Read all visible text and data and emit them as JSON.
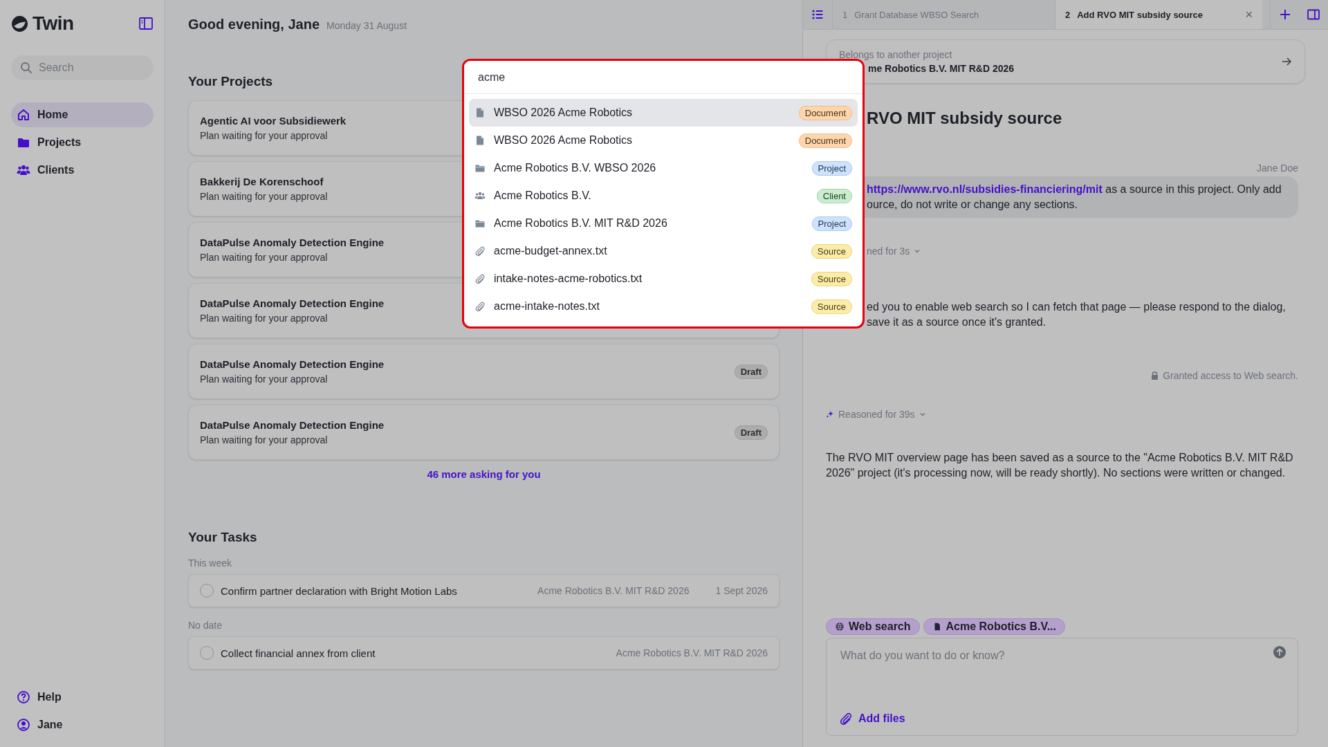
{
  "sidebar": {
    "logo": "Twin",
    "search": {
      "placeholder": "Search"
    },
    "nav": [
      {
        "label": "Home",
        "selected": true
      },
      {
        "label": "Projects",
        "selected": false
      },
      {
        "label": "Clients",
        "selected": false
      }
    ],
    "footer": [
      {
        "label": "Help"
      },
      {
        "label": "Jane"
      }
    ]
  },
  "header": {
    "greeting": "Good evening, Jane",
    "date": "Monday 31 August"
  },
  "projects": {
    "title": "Your Projects",
    "items": [
      {
        "name": "Agentic AI voor Subsidiewerk",
        "status": "Plan waiting for your approval"
      },
      {
        "name": "Bakkerij De Korenschoof",
        "status": "Plan waiting for your approval"
      },
      {
        "name": "DataPulse Anomaly Detection Engine",
        "status": "Plan waiting for your approval"
      },
      {
        "name": "DataPulse Anomaly Detection Engine",
        "status": "Plan waiting for your approval"
      },
      {
        "name": "DataPulse Anomaly Detection Engine",
        "status": "Plan waiting for your approval",
        "badge": "Draft"
      },
      {
        "name": "DataPulse Anomaly Detection Engine",
        "status": "Plan waiting for your approval",
        "badge": "Draft"
      }
    ],
    "more_link": "46 more asking for you"
  },
  "tasks": {
    "title": "Your Tasks",
    "groups": [
      {
        "label": "This week",
        "items": [
          {
            "title": "Confirm partner declaration with Bright Motion Labs",
            "project": "Acme Robotics B.V. MIT R&D 2026",
            "due": "1 Sept 2026",
            "checked": false
          }
        ]
      },
      {
        "label": "No date",
        "items": [
          {
            "title": "Collect financial annex from client",
            "project": "Acme Robotics B.V. MIT R&D 2026",
            "checked": false
          }
        ]
      }
    ]
  },
  "chat": {
    "tabs": [
      {
        "number": "1",
        "label": "Grant Database WBSO Search",
        "selected": false
      },
      {
        "number": "2",
        "label": "Add RVO MIT subsidy source",
        "selected": true,
        "close": "×"
      }
    ],
    "project_card": {
      "label": "Belongs to another project",
      "name": "me Robotics B.V. MIT R&D 2026"
    },
    "title": "RVO MIT subsidy source",
    "messages": [
      {
        "kind": "user",
        "author": "Jane Doe",
        "link": "https://www.rvo.nl/subsidies-financiering/mit",
        "lines": [
          "as a source in this project. Only add",
          "ource, do not write or change any sections."
        ]
      },
      {
        "kind": "reasoning",
        "text": "ned for 3s",
        "partial": true
      },
      {
        "kind": "reply",
        "lines": [
          "ed you to enable web search so I can fetch that page — please respond to the dialog,",
          "save it as a source once it's granted."
        ]
      },
      {
        "kind": "notice",
        "text": "Granted access to Web search."
      },
      {
        "kind": "reasoning",
        "text": "Reasoned for 39s",
        "partial": false
      },
      {
        "kind": "reply",
        "text": "The RVO MIT overview page has been saved as a source to the \"Acme Robotics B.V. MIT R&D 2026\" project (it's processing now, will be ready shortly). No sections were written or changed."
      }
    ],
    "chips": [
      {
        "label": "Web search",
        "kind": "web"
      },
      {
        "label": "Acme Robotics B.V...",
        "kind": "document"
      }
    ],
    "composer": {
      "placeholder": "What do you want to do or know?",
      "add_files": "Add files"
    }
  },
  "search_popup": {
    "query": "acme",
    "results": [
      {
        "title": "WBSO 2026 Acme Robotics",
        "kind": "document",
        "badge": "Document",
        "selected": true
      },
      {
        "title": "WBSO 2026 Acme Robotics",
        "kind": "document",
        "badge": "Document",
        "selected": false
      },
      {
        "title": "Acme Robotics B.V. WBSO 2026",
        "kind": "project",
        "badge": "Project",
        "selected": false
      },
      {
        "title": "Acme Robotics B.V.",
        "kind": "client",
        "badge": "Client",
        "selected": false
      },
      {
        "title": "Acme Robotics B.V. MIT R&D 2026",
        "kind": "project",
        "badge": "Project",
        "selected": false
      },
      {
        "title": "acme-budget-annex.txt",
        "kind": "source",
        "badge": "Source",
        "selected": false
      },
      {
        "title": "intake-notes-acme-robotics.txt",
        "kind": "source",
        "badge": "Source",
        "selected": false
      },
      {
        "title": "acme-intake-notes.txt",
        "kind": "source",
        "badge": "Source",
        "selected": false
      }
    ]
  }
}
